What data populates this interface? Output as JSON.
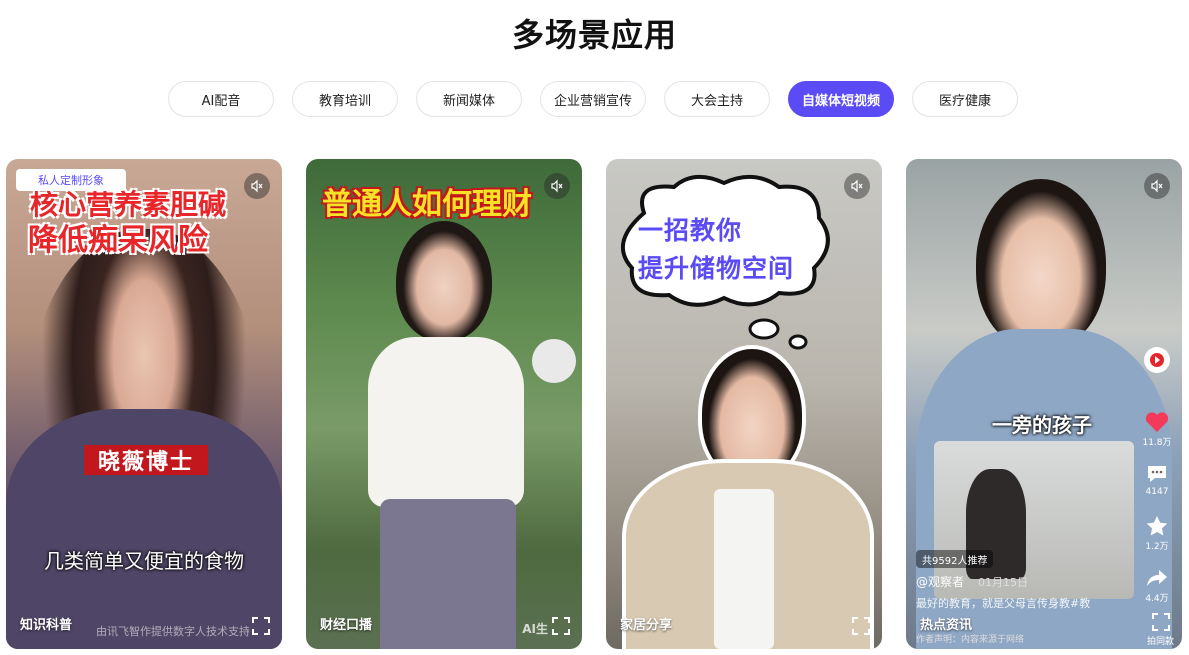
{
  "page": {
    "title": "多场景应用"
  },
  "tabs": [
    {
      "label": "AI配音",
      "active": false
    },
    {
      "label": "教育培训",
      "active": false
    },
    {
      "label": "新闻媒体",
      "active": false
    },
    {
      "label": "企业营销宣传",
      "active": false
    },
    {
      "label": "大会主持",
      "active": false
    },
    {
      "label": "自媒体短视频",
      "active": true
    },
    {
      "label": "医疗健康",
      "active": false
    }
  ],
  "cards": [
    {
      "label": "知识科普",
      "badge": "私人定制形象",
      "headline_line1": "核心营养素胆碱",
      "headline_line2": "降低痴呆风险",
      "name_tag": "晓薇博士",
      "subtitle": "几类简单又便宜的食物",
      "watermark": "由讯飞智作提供数字人技术支持"
    },
    {
      "label": "财经口播",
      "headline": "普通人如何理财",
      "ai_mark": "AI生"
    },
    {
      "label": "家居分享",
      "bubble_line1": "一招教你",
      "bubble_line2": "提升储物空间"
    },
    {
      "label": "热点资讯",
      "overlay_text": "一旁的孩子",
      "likes": "11.8万",
      "comments": "4147",
      "favorites": "1.2万",
      "shares": "4.4万",
      "recommend": "共9592人推荐",
      "author": "@观察者",
      "date": "01月15日",
      "description": "最好的教育，就是父母言传身教#教",
      "notice": "作者声明：内容来源于网络",
      "corner": "拍同款"
    }
  ],
  "colors": {
    "accent": "#5b4bf5",
    "headline_red": "#e8262a",
    "name_tag_red": "#c2171c"
  }
}
